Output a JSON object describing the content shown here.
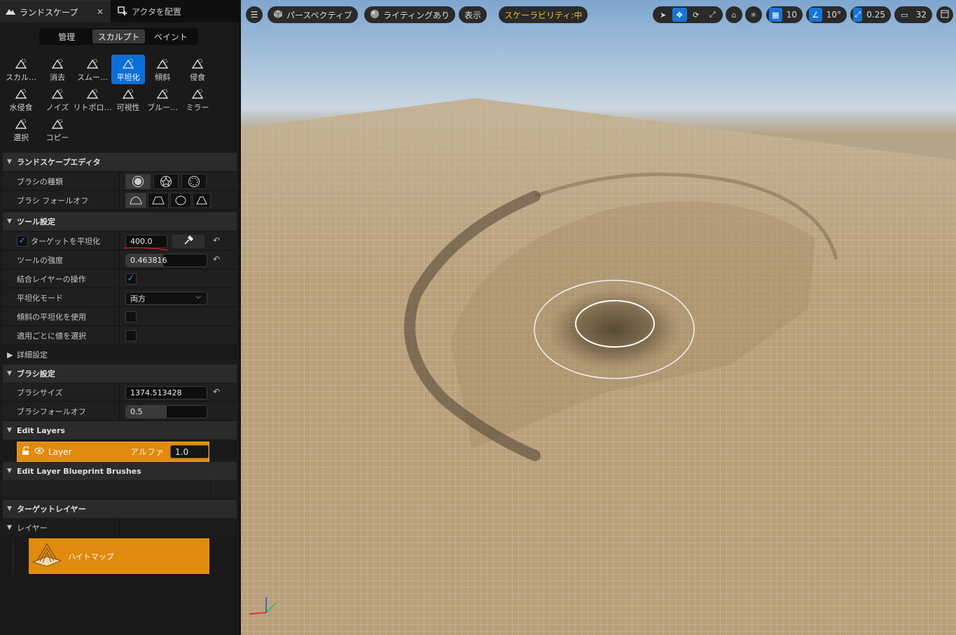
{
  "tabs": [
    {
      "label": "ランドスケープ",
      "icon": "landscape-icon"
    },
    {
      "label": "アクタを配置",
      "icon": "place-actor-icon"
    }
  ],
  "modes": [
    "管理",
    "スカルプト",
    "ペイント"
  ],
  "active_mode": "スカルプト",
  "tools": [
    {
      "label": "スカル…",
      "icon": "sculpt-icon"
    },
    {
      "label": "消去",
      "icon": "erase-icon"
    },
    {
      "label": "スムー…",
      "icon": "smooth-icon"
    },
    {
      "label": "平坦化",
      "icon": "flatten-icon"
    },
    {
      "label": "傾斜",
      "icon": "ramp-icon"
    },
    {
      "label": "侵食",
      "icon": "erosion-icon"
    },
    {
      "label": "水侵食",
      "icon": "hydro-erosion-icon"
    },
    {
      "label": "ノイズ",
      "icon": "noise-icon"
    },
    {
      "label": "リトポロ…",
      "icon": "retopologize-icon"
    },
    {
      "label": "可視性",
      "icon": "visibility-icon"
    },
    {
      "label": "ブルー…",
      "icon": "blueprint-icon"
    },
    {
      "label": "ミラー",
      "icon": "mirror-icon"
    },
    {
      "label": "選択",
      "icon": "select-icon"
    },
    {
      "label": "コピー",
      "icon": "copy-icon"
    }
  ],
  "sections": {
    "landscape_editor": "ランドスケープエディタ",
    "tool_settings": "ツール設定",
    "advanced": "詳細設定",
    "brush_settings": "ブラシ設定",
    "edit_layers": "Edit Layers",
    "edit_layer_bp": "Edit Layer Blueprint Brushes",
    "target_layers": "ターゲットレイヤー",
    "layers": "レイヤー"
  },
  "props": {
    "brush_type": "ブラシの種類",
    "brush_falloff_type": "ブラシ フォールオフ",
    "flatten_target": "ターゲットを平坦化",
    "flatten_target_value": "400.0",
    "tool_strength": "ツールの強度",
    "tool_strength_value": "0.463816",
    "tool_strength_fraction": 0.46,
    "combined_layers": "結合レイヤーの操作",
    "flatten_mode": "平坦化モード",
    "flatten_mode_value": "両方",
    "use_slope": "傾斜の平坦化を使用",
    "pick_per_apply": "適用ごとに値を選択",
    "brush_size": "ブラシサイズ",
    "brush_size_value": "1374.513428",
    "brush_falloff": "ブラシフォールオフ",
    "brush_falloff_value": "0.5",
    "brush_falloff_fraction": 0.5
  },
  "edit_layer": {
    "name": "Layer",
    "alpha_label": "アルファ",
    "alpha_value": "1.0"
  },
  "heightmap_label": "ハイトマップ",
  "viewport": {
    "perspective": "パースペクティブ",
    "lighting": "ライティングあり",
    "show": "表示",
    "scalability": "スケーラビリティ:中",
    "grid_snap": "10",
    "rotation_snap": "10°",
    "scale_snap": "0.25",
    "camera_speed": "32"
  },
  "colors": {
    "accent": "#0a6fd9",
    "layer_orange": "#e08a0e",
    "scalability_yellow": "#f0c020"
  }
}
